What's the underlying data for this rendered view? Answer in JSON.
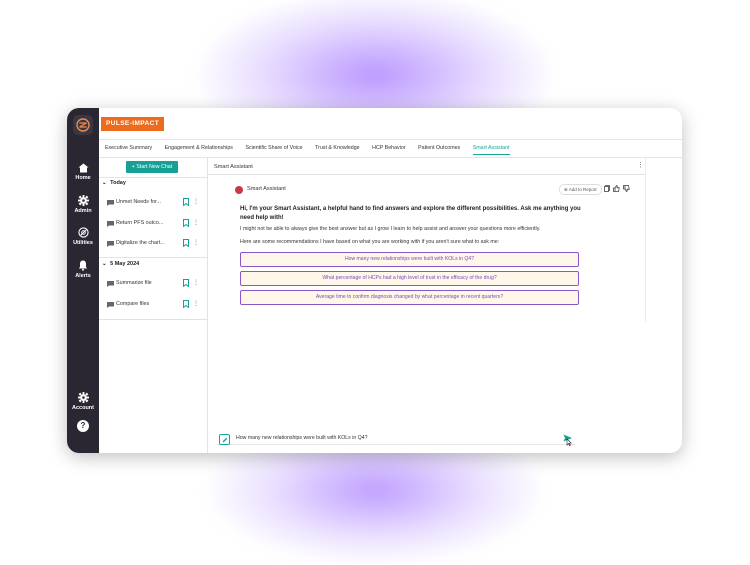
{
  "brand": {
    "name": "PULSE-IMPACT"
  },
  "sidebar": {
    "items": [
      {
        "label": "Home",
        "icon": "home-icon"
      },
      {
        "label": "Admin",
        "icon": "gear-icon"
      },
      {
        "label": "Utilities",
        "icon": "utilities-icon"
      },
      {
        "label": "Alerts",
        "icon": "bell-icon"
      }
    ],
    "account": {
      "label": "Account",
      "icon": "gear-icon"
    },
    "help": {
      "label": "?",
      "icon": "help-icon"
    }
  },
  "tabs": [
    {
      "label": "Executive Summary"
    },
    {
      "label": "Engagement & Relationships"
    },
    {
      "label": "Scientific Share of Voice"
    },
    {
      "label": "Trust & Knowledge"
    },
    {
      "label": "HCP Behavior"
    },
    {
      "label": "Patient Outcomes"
    },
    {
      "label": "Smart Assistant",
      "active": true
    }
  ],
  "chat_list": {
    "new_chat_label": "+ Start New Chat",
    "groups": [
      {
        "title": "Today",
        "items": [
          {
            "label": "Unmet Needs for..."
          },
          {
            "label": "Return PFS outco..."
          },
          {
            "label": "Digitalize the chart..."
          }
        ]
      },
      {
        "title": "5 May 2024",
        "items": [
          {
            "label": "Summarize file"
          },
          {
            "label": "Compare files"
          }
        ]
      }
    ]
  },
  "panel": {
    "title": "Smart Assistant",
    "assistant_name": "Smart Assistant",
    "add_to_report": "Add to Report",
    "greeting": "Hi, I'm your Smart Assistant, a helpful hand to find answers and explore the different possibilities. Ask me anything you need help with!",
    "disclaimer": "I might not be able to always give the best answer but as I grow I learn to help assist and answer your questions more efficiently.",
    "recommend_intro": "Here are some recommendations I have based on what you are working with if you aren't sure what to ask me:",
    "suggestions": [
      "How many new relationships were built with KOLs in Q4?",
      "What percentage of HCPs had a high level of trust in the efficacy of the drug?",
      "Average time to confirm diagnosis changed by what percentage in recent quarters?"
    ],
    "input_value": "How many new relationships were built with KOLs in Q4?"
  },
  "colors": {
    "brand_orange": "#ec6b1c",
    "teal_accent": "#15a195",
    "sidebar_dark": "#2a2733",
    "suggestion_border": "#8a57c9",
    "suggestion_bg": "#fff8ea"
  }
}
